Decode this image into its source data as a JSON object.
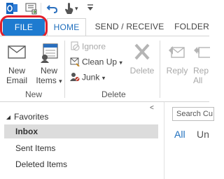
{
  "quick_access": {
    "icons": [
      "outlook-app-icon",
      "send-receive-all-icon",
      "undo-icon",
      "touch-mouse-mode-icon",
      "customize-toolbar-icon"
    ]
  },
  "tabs": [
    {
      "label": "FILE"
    },
    {
      "label": "HOME"
    },
    {
      "label": "SEND / RECEIVE"
    },
    {
      "label": "FOLDER"
    }
  ],
  "ribbon": {
    "new_group": {
      "label": "New",
      "new_email": "New Email",
      "new_email_l1": "New",
      "new_email_l2": "Email",
      "new_items_l1": "New",
      "new_items_l2": "Items",
      "dropdown_glyph": "▾"
    },
    "delete_group": {
      "label": "Delete",
      "ignore": "Ignore",
      "clean_up": "Clean Up",
      "junk": "Junk",
      "delete": "Delete"
    },
    "respond_group": {
      "reply": "Reply",
      "reply_all_l1": "Rep",
      "reply_all_l2": "All"
    }
  },
  "folder_pane": {
    "collapse_glyph": "<",
    "favorites_label": "Favorites",
    "folders": [
      "Inbox",
      "Sent Items",
      "Deleted Items"
    ]
  },
  "message_list": {
    "search_placeholder": "Search Cu",
    "filter_all": "All",
    "filter_unread": "Un"
  },
  "colors": {
    "file_tab": "#1e7bd0",
    "highlight_ring": "#e3202b",
    "home_tab_text": "#1e6ebd",
    "selected_folder": "#dcdcdc",
    "filter_all": "#1e6ebd"
  }
}
